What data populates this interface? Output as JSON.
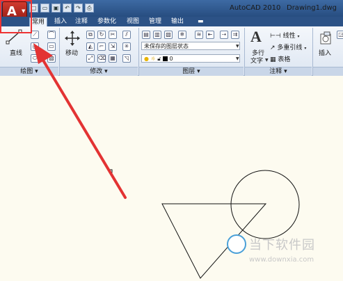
{
  "app": {
    "logo_letter": "A",
    "name": "AutoCAD 2010",
    "file": "Drawing1.dwg"
  },
  "quick_access": [
    "new",
    "open",
    "save",
    "undo",
    "redo",
    "plot"
  ],
  "tabs": [
    "常用",
    "插入",
    "注释",
    "参数化",
    "视图",
    "管理",
    "输出"
  ],
  "panels": {
    "draw": {
      "label": "绘图",
      "line_label": "直线"
    },
    "modify": {
      "label": "修改",
      "move_label": "移动"
    },
    "layers": {
      "label": "图层",
      "layer_state": "未保存的图层状态",
      "current_layer": "0"
    },
    "annotation": {
      "label": "注释",
      "mtext_label_1": "多行",
      "mtext_label_2": "文字",
      "linear_label": "线性",
      "multileader_label": "多重引线",
      "table_label": "表格"
    },
    "block": {
      "insert_label": "插入"
    }
  },
  "watermark": {
    "text": "当下软件园",
    "url": "www.downxia.com"
  },
  "colors": {
    "annotation_red": "#e33333",
    "canvas_bg": "#fdfbf0",
    "ribbon_bg": "#dde6f2",
    "titlebar": "#2c5286"
  }
}
